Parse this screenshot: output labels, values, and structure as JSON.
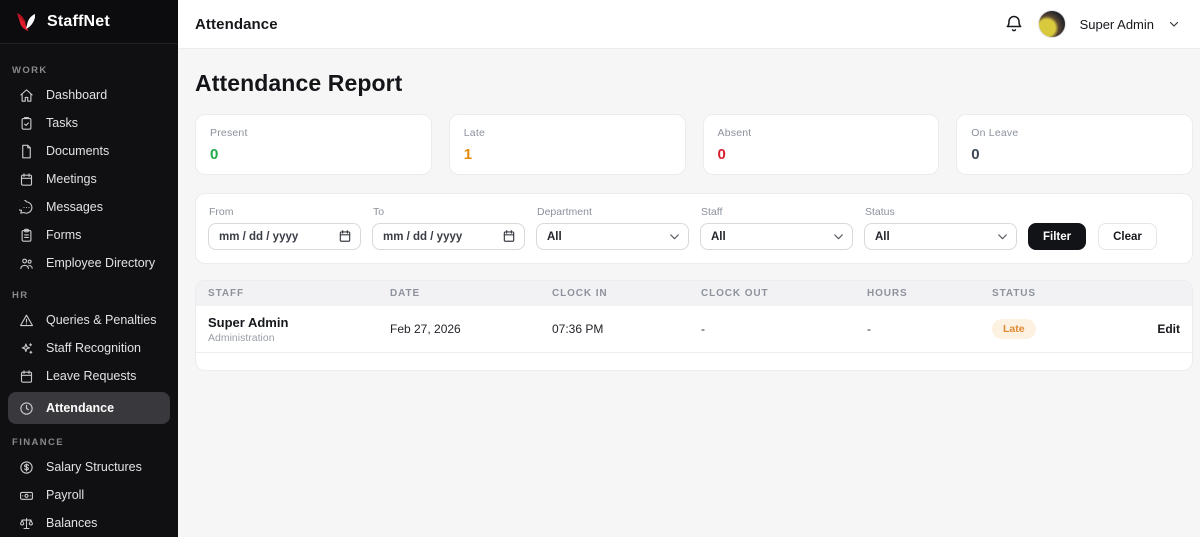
{
  "brand": {
    "name": "StaffNet"
  },
  "topbar": {
    "title": "Attendance",
    "user_name": "Super Admin"
  },
  "sidebar": {
    "sections": [
      {
        "label": "WORK",
        "items": [
          {
            "label": "Dashboard"
          },
          {
            "label": "Tasks"
          },
          {
            "label": "Documents"
          },
          {
            "label": "Meetings"
          },
          {
            "label": "Messages"
          },
          {
            "label": "Forms"
          },
          {
            "label": "Employee Directory"
          }
        ]
      },
      {
        "label": "HR",
        "items": [
          {
            "label": "Queries & Penalties"
          },
          {
            "label": "Staff Recognition"
          },
          {
            "label": "Leave Requests"
          },
          {
            "label": "Attendance",
            "active": true
          }
        ]
      },
      {
        "label": "FINANCE",
        "items": [
          {
            "label": "Salary Structures"
          },
          {
            "label": "Payroll"
          },
          {
            "label": "Balances"
          }
        ]
      }
    ]
  },
  "main": {
    "heading": "Attendance Report",
    "stats": [
      {
        "label": "Present",
        "value": "0",
        "color": "#22a94b"
      },
      {
        "label": "Late",
        "value": "1",
        "color": "#e68a0d"
      },
      {
        "label": "Absent",
        "value": "0",
        "color": "#d91f2f"
      },
      {
        "label": "On Leave",
        "value": "0",
        "color": "#3d4757"
      }
    ],
    "filters": {
      "from_label": "From",
      "to_label": "To",
      "date_placeholder": "mm / dd / yyyy",
      "department_label": "Department",
      "staff_label": "Staff",
      "status_label": "Status",
      "select_value": "All",
      "filter_button": "Filter",
      "clear_button": "Clear"
    },
    "table": {
      "headers": [
        "Staff",
        "Date",
        "Clock In",
        "Clock Out",
        "Hours",
        "Status"
      ],
      "status_badge_colors": {
        "text": "#dd8a33",
        "background": "#fdf1e2"
      },
      "rows": [
        {
          "staff": "Super Admin",
          "department": "Administration",
          "date": "Feb 27, 2026",
          "clock_in": "07:36 PM",
          "clock_out": "-",
          "hours": "-",
          "status": "Late",
          "action": "Edit"
        }
      ]
    }
  }
}
